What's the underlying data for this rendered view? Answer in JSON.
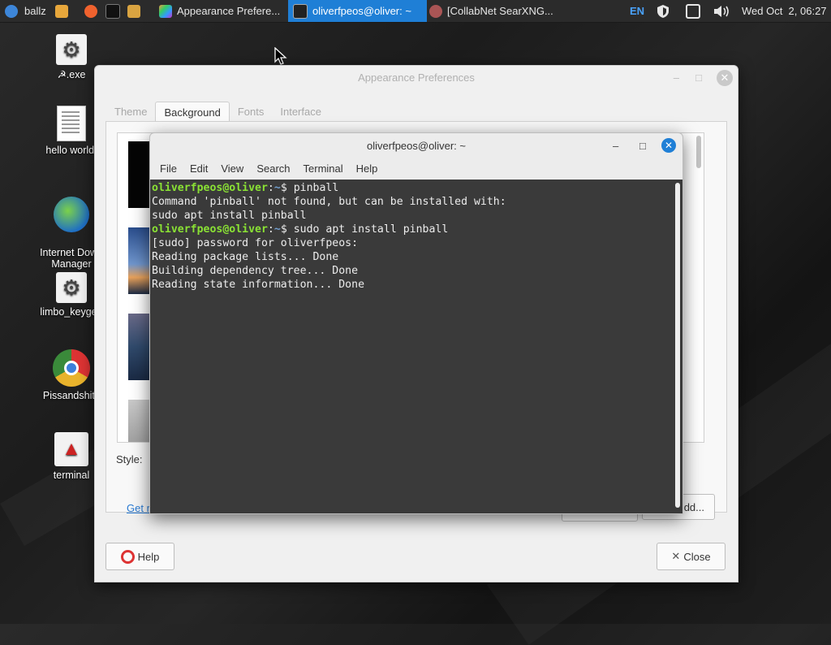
{
  "taskbar": {
    "workspace_label": "ballz",
    "tasks": [
      {
        "label": "Appearance Prefere...",
        "active": false
      },
      {
        "label": "oliverfpeos@oliver: ~",
        "active": true
      },
      {
        "label": "[CollabNet SearXNG...",
        "active": false
      }
    ],
    "keyboard_layout": "EN",
    "clock": "Wed Oct  2, 06:27"
  },
  "desktop": {
    "icons": [
      {
        "label": "☭.exe",
        "icon": "gear-icon"
      },
      {
        "label": "hello world.",
        "icon": "text-file-icon"
      },
      {
        "label": "Internet Down\nManager",
        "icon": "download-manager-icon"
      },
      {
        "label": "limbo_keygen",
        "icon": "gear-icon"
      },
      {
        "label": "Pissandshitti",
        "icon": "chrome-icon"
      },
      {
        "label": "terminal",
        "icon": "rocket-icon"
      }
    ]
  },
  "appearance": {
    "title": "Appearance Preferences",
    "tabs": [
      {
        "label": "Theme",
        "active": false
      },
      {
        "label": "Background",
        "active": true
      },
      {
        "label": "Fonts",
        "active": false
      },
      {
        "label": "Interface",
        "active": false
      }
    ],
    "style_label": "Style:",
    "get_more_link": "Get r",
    "add_button": "dd...",
    "help_button": "Help",
    "close_button": "Close"
  },
  "terminal": {
    "title": "oliverfpeos@oliver: ~",
    "menu": [
      "File",
      "Edit",
      "View",
      "Search",
      "Terminal",
      "Help"
    ],
    "lines": [
      {
        "user": "oliverfpeos@oliver",
        "path": "~",
        "cmd": " pinball"
      },
      {
        "text": "Command 'pinball' not found, but can be installed with:"
      },
      {
        "text": "sudo apt install pinball"
      },
      {
        "user": "oliverfpeos@oliver",
        "path": "~",
        "cmd": " sudo apt install pinball"
      },
      {
        "text": "[sudo] password for oliverfpeos:"
      },
      {
        "text": "Reading package lists... Done"
      },
      {
        "text": "Building dependency tree... Done"
      },
      {
        "text": "Reading state information... Done"
      }
    ]
  },
  "colors": {
    "accent": "#1f7fd6",
    "prompt_user": "#8ae234",
    "prompt_path": "#729fcf",
    "terminal_bg": "#3a3a3a"
  }
}
